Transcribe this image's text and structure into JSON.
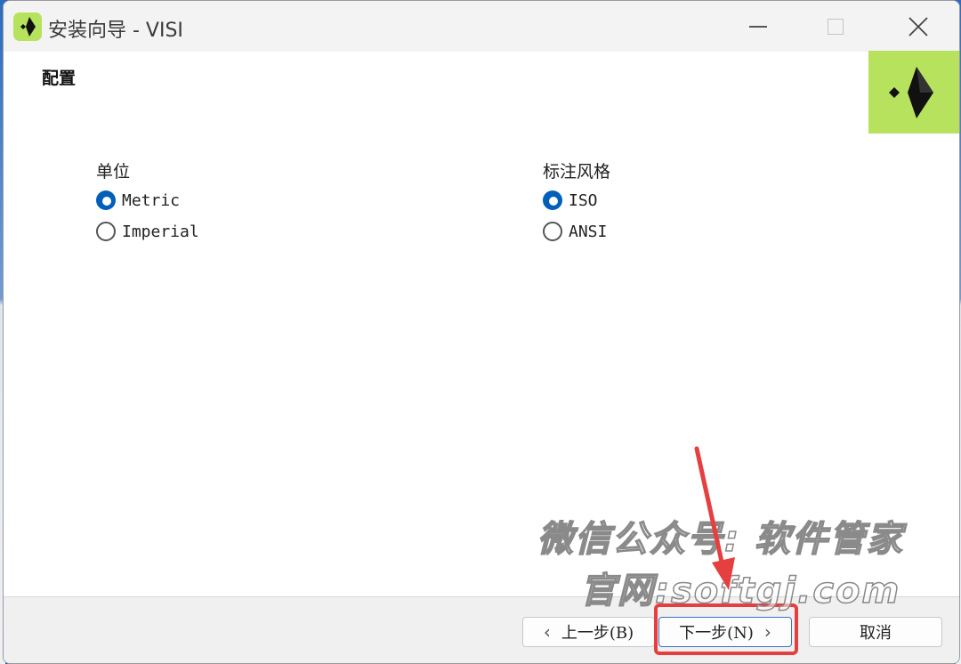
{
  "window": {
    "title": "安装向导 - VISI"
  },
  "page": {
    "section_title": "配置"
  },
  "units": {
    "title": "单位",
    "options": [
      {
        "label": "Metric",
        "checked": true
      },
      {
        "label": "Imperial",
        "checked": false
      }
    ]
  },
  "style": {
    "title": "标注风格",
    "options": [
      {
        "label": "ISO",
        "checked": true
      },
      {
        "label": "ANSI",
        "checked": false
      }
    ]
  },
  "buttons": {
    "back": "上一步(B)",
    "next": "下一步(N)",
    "cancel": "取消"
  },
  "watermark": {
    "line1": "微信公众号: 软件管家",
    "line2": "官网:softgj.com"
  },
  "colors": {
    "accent": "#005fb8",
    "brand": "#b7e25e",
    "annotation": "#e53f3f"
  }
}
